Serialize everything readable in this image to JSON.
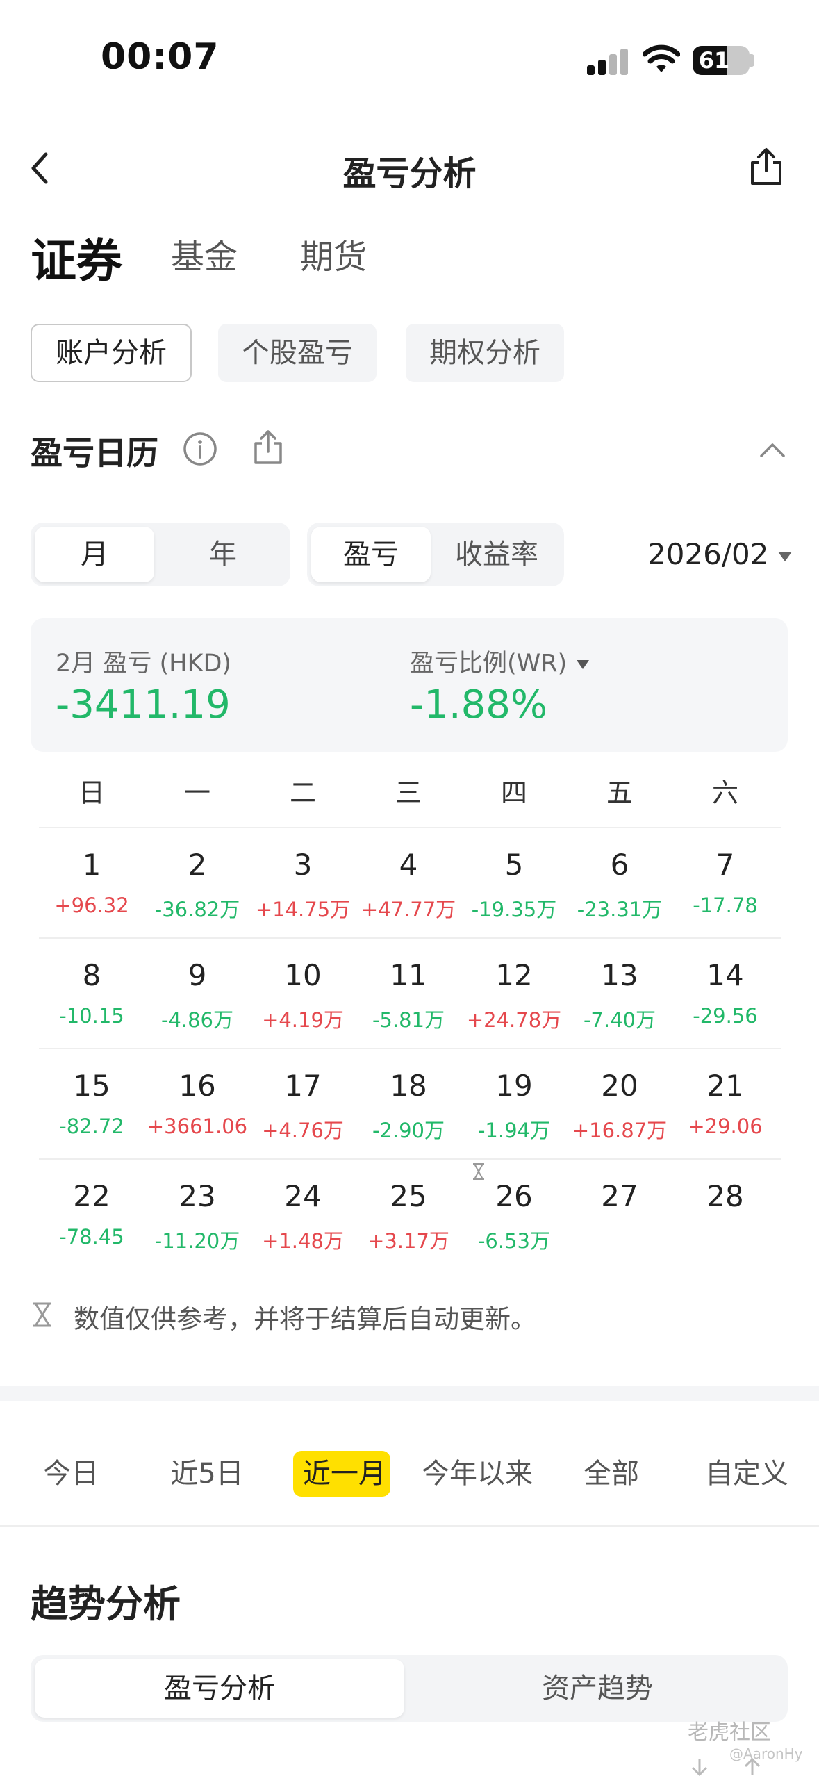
{
  "status_bar": {
    "time": "00:07",
    "battery": "61",
    "battery_level": 0.61
  },
  "nav": {
    "title": "盈亏分析"
  },
  "category_tabs": [
    {
      "label": "证券",
      "active": true
    },
    {
      "label": "基金",
      "active": false
    },
    {
      "label": "期货",
      "active": false
    }
  ],
  "sub_tabs": [
    {
      "label": "账户分析",
      "active": true
    },
    {
      "label": "个股盈亏",
      "active": false
    },
    {
      "label": "期权分析",
      "active": false
    }
  ],
  "calendar": {
    "title": "盈亏日历",
    "mode_toggle": {
      "month": "月",
      "year": "年",
      "selected": "月"
    },
    "metric_toggle": {
      "pnl": "盈亏",
      "yield": "收益率",
      "selected": "盈亏"
    },
    "month_value": "2026/02",
    "summary": {
      "pnl_label": "2月 盈亏 (HKD)",
      "pnl_value": "-3411.19",
      "ratio_label": "盈亏比例(WR)",
      "ratio_value": "-1.88%"
    },
    "weekdays": [
      "日",
      "一",
      "二",
      "三",
      "四",
      "五",
      "六"
    ],
    "weeks": [
      [
        {
          "day": "1",
          "pl": "+96.32",
          "sign": "pos"
        },
        {
          "day": "2",
          "pl": "-36.82万",
          "sign": "neg"
        },
        {
          "day": "3",
          "pl": "+14.75万",
          "sign": "pos"
        },
        {
          "day": "4",
          "pl": "+47.77万",
          "sign": "pos"
        },
        {
          "day": "5",
          "pl": "-19.35万",
          "sign": "neg"
        },
        {
          "day": "6",
          "pl": "-23.31万",
          "sign": "neg"
        },
        {
          "day": "7",
          "pl": "-17.78",
          "sign": "neg"
        }
      ],
      [
        {
          "day": "8",
          "pl": "-10.15",
          "sign": "neg"
        },
        {
          "day": "9",
          "pl": "-4.86万",
          "sign": "neg"
        },
        {
          "day": "10",
          "pl": "+4.19万",
          "sign": "pos"
        },
        {
          "day": "11",
          "pl": "-5.81万",
          "sign": "neg"
        },
        {
          "day": "12",
          "pl": "+24.78万",
          "sign": "pos"
        },
        {
          "day": "13",
          "pl": "-7.40万",
          "sign": "neg"
        },
        {
          "day": "14",
          "pl": "-29.56",
          "sign": "neg"
        }
      ],
      [
        {
          "day": "15",
          "pl": "-82.72",
          "sign": "neg"
        },
        {
          "day": "16",
          "pl": "+3661.06",
          "sign": "pos"
        },
        {
          "day": "17",
          "pl": "+4.76万",
          "sign": "pos"
        },
        {
          "day": "18",
          "pl": "-2.90万",
          "sign": "neg"
        },
        {
          "day": "19",
          "pl": "-1.94万",
          "sign": "neg"
        },
        {
          "day": "20",
          "pl": "+16.87万",
          "sign": "pos"
        },
        {
          "day": "21",
          "pl": "+29.06",
          "sign": "pos"
        }
      ],
      [
        {
          "day": "22",
          "pl": "-78.45",
          "sign": "neg"
        },
        {
          "day": "23",
          "pl": "-11.20万",
          "sign": "neg"
        },
        {
          "day": "24",
          "pl": "+1.48万",
          "sign": "pos"
        },
        {
          "day": "25",
          "pl": "+3.17万",
          "sign": "pos"
        },
        {
          "day": "26",
          "pl": "-6.53万",
          "sign": "neg"
        },
        {
          "day": "27",
          "pl": "",
          "sign": ""
        },
        {
          "day": "28",
          "pl": "",
          "sign": ""
        }
      ]
    ],
    "note": "数值仅供参考，并将于结算后自动更新。"
  },
  "period_tabs": [
    {
      "label": "今日",
      "active": false
    },
    {
      "label": "近5日",
      "active": false
    },
    {
      "label": "近一月",
      "active": true
    },
    {
      "label": "今年以来",
      "active": false
    },
    {
      "label": "全部",
      "active": false
    },
    {
      "label": "自定义",
      "active": false
    }
  ],
  "trend": {
    "title": "趋势分析",
    "tabs": [
      {
        "label": "盈亏分析",
        "active": true
      },
      {
        "label": "资产趋势",
        "active": false
      }
    ]
  },
  "watermark": {
    "brand": "老虎社区",
    "user": "@AaronHy"
  },
  "colors": {
    "positive": "#e5484d",
    "negative": "#22b869",
    "accent": "#ffe000"
  }
}
